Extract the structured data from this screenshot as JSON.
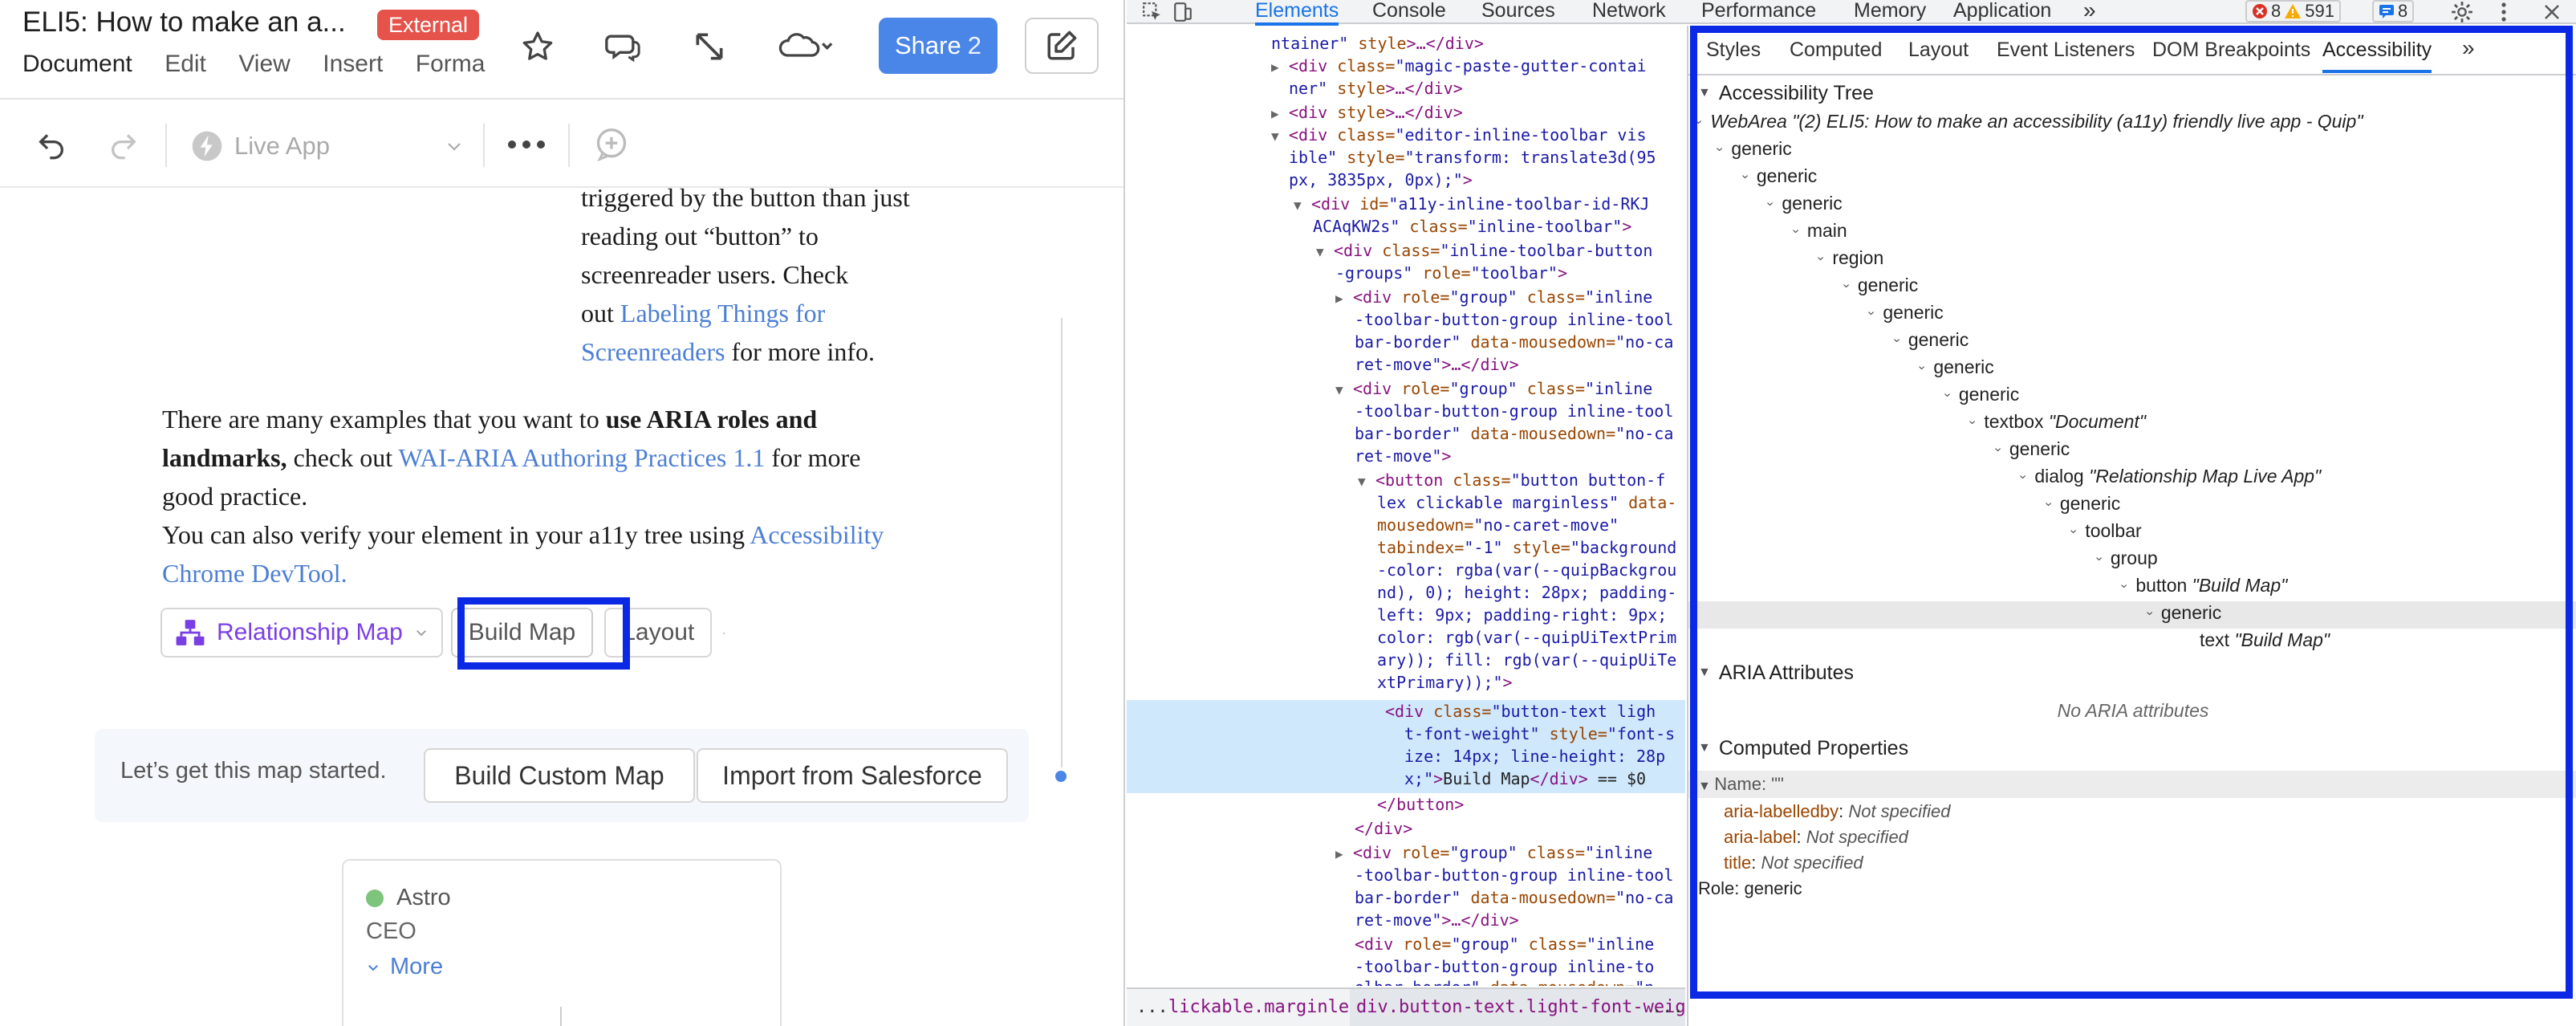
{
  "quip": {
    "doc_title": "ELI5: How to make an a...",
    "external_badge": "External",
    "menu": [
      "Document",
      "Edit",
      "View",
      "Insert",
      "Forma"
    ],
    "share_label": "Share",
    "share_count": "2",
    "live_app_label": "Live App",
    "doc": {
      "p1_line1": "triggered by the button than just",
      "p1_line2": "reading out “button” to",
      "p1_line3": "screenreader users.  Check",
      "p1_out": "out ",
      "p1_link": "Labeling Things for",
      "p1_link2": "Screenreaders",
      "p1_tail": " for more info.",
      "p2_a": "There are many examples that you want to ",
      "p2_bold": "use ARIA roles and",
      "p2_bold2": "landmarks,",
      "p2_b": " check out ",
      "p2_link": "WAI-ARIA Authoring Practices 1.1",
      "p2_c": " for more",
      "p2_line3": "good practice.",
      "p3_a": "You can also verify your element in your a11y tree using ",
      "p3_link": "Accessibility",
      "p3_link2": "Chrome DevTool."
    },
    "app_toolbar": {
      "relationship_map": "Relationship Map",
      "build_map": "Build Map",
      "layout": "Layout"
    },
    "banner": {
      "text": "Let’s get this map started.",
      "build_custom": "Build Custom Map",
      "import_sf": "Import from Salesforce"
    },
    "card": {
      "name": "Astro",
      "role": "CEO",
      "more": "More"
    }
  },
  "devtools": {
    "tabs": [
      "Elements",
      "Console",
      "Sources",
      "Network",
      "Performance",
      "Memory",
      "Application"
    ],
    "more_tabs": "»",
    "errors": "8",
    "warnings": "591",
    "messages": "8",
    "elements": {
      "l0_tail": "ntainer\"",
      "l0_style": " style",
      "l0_end": ">…</div>",
      "l1": "magic-paste-gutter-contai",
      "l1b": "ner\"",
      "l2_tag": "<div",
      "l2_attr": " style",
      "l2_end": ">…</div>",
      "l3_val": "\"editor-inline-toolbar vis",
      "l3b_val": "ible\"",
      "l3b_style": " style=",
      "l3b_sv": "\"transform: translate3d(95",
      "l3c": "px, 3835px, 0px);\"",
      "l4_id": "\"a11y-inline-toolbar-id-RKJ",
      "l4b": "ACAqKW2s\"",
      "l4b_class": " class=",
      "l4b_cv": "\"inline-toolbar\"",
      "l5_val": "\"inline-toolbar-button",
      "l5b": "-groups\"",
      "l5b_role": " role=",
      "l5b_rv": "\"toolbar\"",
      "l6_val": "\"group\"",
      "l6_cls": "\"inline",
      "l6b": "-toolbar-button-group inline-tool",
      "l6c": "bar-border\"",
      "l6c_attr": " data-mousedown=",
      "l6c_v": "\"no-ca",
      "l6d": "ret-move\"",
      "l6d_end": ">…</div>",
      "l7_cls": "\"inline",
      "l7b": "-toolbar-button-group inline-tool",
      "l7c": "bar-border\"",
      "l7c_attr": " data-mousedown=",
      "l7c_v": "\"no-ca",
      "l7d": "ret-move\"",
      "btn_cls": "\"button button-f",
      "btn2": "lex clickable marginless\"",
      "btn2_attr": " data-",
      "btn3": "mousedown=",
      "btn3_v": "\"no-caret-move\"",
      "btn4": "tabindex=",
      "btn4_v": "\"-1\"",
      "btn4_style": " style=",
      "btn4_sv": "\"background",
      "btn5": "-color: rgba(var(--quipBackgrou",
      "btn6": "nd), 0); height: 28px; padding-",
      "btn7": "left: 9px; padding-right: 9px;",
      "btn8": "color: rgb(var(--quipUiTextPrim",
      "btn9": "ary)); fill: rgb(var(--quipUiTe",
      "btn10": "xtPrimary));\"",
      "sel1_cls": "\"button-text ligh",
      "sel2": "t-font-weight\"",
      "sel2_style": " style=",
      "sel2_sv": "\"font-s",
      "sel3": "ize: 14px; line-height: 28p",
      "sel4": "x;\"",
      "sel4_txt": "Build Map",
      "sel4_eq": " == $0",
      "close_btn": "</button>",
      "close_div": "</div>",
      "g3_cls": "\"inline",
      "g3b": "-toolbar-button-group inline-tool",
      "g3c": "bar-border\"",
      "g3c_attr": " data-mousedown=",
      "g3c_v": "\"no-ca",
      "g3d": "ret-move\"",
      "g3d_end": ">…</div>",
      "g4_cls": "\"inline",
      "g4b": "-toolbar-button-group inline-to",
      "g4c": "olbar-border\"",
      "g4c_attr": " data-mousedown=",
      "g4c_v": "\"n"
    },
    "breadcrumbs": {
      "dots": "...",
      "c1": "lickable.marginless",
      "c2": "div.button-text.light-font-weight",
      "dots2": "..."
    },
    "sidebar_tabs": [
      "Styles",
      "Computed",
      "Layout",
      "Event Listeners",
      "DOM Breakpoints",
      "Accessibility"
    ],
    "sidebar_more": "»",
    "ax_header": "Accessibility Tree",
    "ax_root_role": "WebArea",
    "ax_root_name": "\"(2) ELI5: How to make an accessibility (a11y) friendly live app - Quip\"",
    "ax_tree": [
      {
        "role": "generic",
        "name": ""
      },
      {
        "role": "generic",
        "name": ""
      },
      {
        "role": "generic",
        "name": ""
      },
      {
        "role": "main",
        "name": ""
      },
      {
        "role": "region",
        "name": ""
      },
      {
        "role": "generic",
        "name": ""
      },
      {
        "role": "generic",
        "name": ""
      },
      {
        "role": "generic",
        "name": ""
      },
      {
        "role": "generic",
        "name": ""
      },
      {
        "role": "generic",
        "name": ""
      },
      {
        "role": "textbox",
        "name": "\"Document\""
      },
      {
        "role": "generic",
        "name": ""
      },
      {
        "role": "dialog",
        "name": "\"Relationship Map Live App\""
      },
      {
        "role": "generic",
        "name": ""
      },
      {
        "role": "toolbar",
        "name": ""
      },
      {
        "role": "group",
        "name": ""
      },
      {
        "role": "button",
        "name": "\"Build Map\""
      },
      {
        "role": "generic",
        "name": ""
      },
      {
        "role": "text",
        "name": "\"Build Map\""
      }
    ],
    "aria_header": "ARIA Attributes",
    "no_aria": "No ARIA attributes",
    "computed_header": "Computed Properties",
    "name_label": "Name:",
    "name_value": "\"\"",
    "props": [
      {
        "k": "aria-labelledby",
        "v": "Not specified"
      },
      {
        "k": "aria-label",
        "v": "Not specified"
      },
      {
        "k": "title",
        "v": "Not specified"
      }
    ],
    "role_label": "Role:",
    "role_value": "generic"
  },
  "colors": {
    "highlight": "#0b28e5",
    "share": "#4a86e8",
    "link": "#4c7fd4",
    "badge": "#e5534b"
  }
}
